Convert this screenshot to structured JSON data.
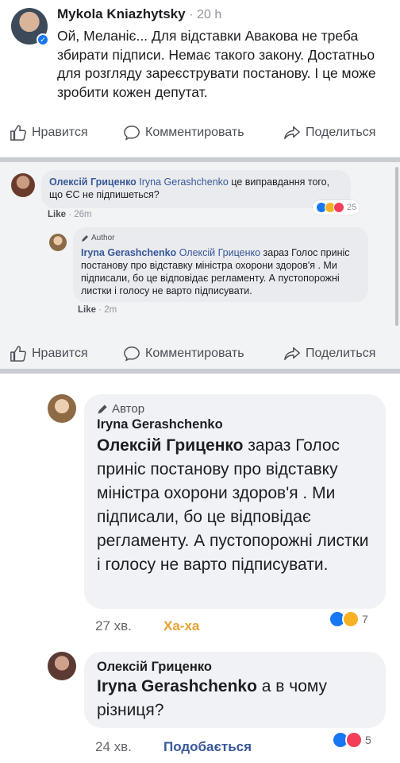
{
  "post": {
    "author": "Mykola Kniazhytsky",
    "time": "· 20 h",
    "text": "Ой, Меланіє... Для відставки Авакова не треба збирати підписи. Немає такого закону. Достатньо для розгляду зареєструвати постанову. І це може зробити кожен депутат."
  },
  "actions": {
    "like": "Нравится",
    "comment": "Комментировать",
    "share": "Поделиться"
  },
  "comment1": {
    "author": "Олексій Гриценко",
    "tag": "Iryna Gerashchenko",
    "text": " це виправдання того, що ЄС не підпишеться?",
    "like": "Like",
    "time": "· 26m",
    "reaction_count": "25"
  },
  "reply1": {
    "badge": "Author",
    "author": "Iryna Gerashchenko",
    "tag": "Олексій Гриценко",
    "text": " зараз Голос приніс постанову про відставку міністра охорони здоров'я . Ми підписали, бо це відповідає регламенту. А пустопорожні листки і голосу не варто підписувати.",
    "like": "Like",
    "time": "· 2m"
  },
  "reply2": {
    "badge": "Автор",
    "author": "Iryna Gerashchenko",
    "tag": "Олексій Гриценко",
    "text": " зараз Голос приніс постанову про відставку міністра охорони здоров'я . Ми підписали, бо це відповідає регламенту. А пустопорожні листки і голосу не варто підписувати.",
    "time": "27 хв.",
    "reaction_label": "Ха-ха",
    "reaction_count": "7"
  },
  "reply3": {
    "author": "Олексій Гриценко",
    "tag": "Iryna Gerashchenko",
    "text": " а в чому різниця?",
    "time": "24 хв.",
    "reaction_label": "Подобається",
    "reaction_count": "5"
  },
  "colors": {
    "link": "#385898",
    "like_blue": "#1877f2",
    "haha_yellow": "#f7b125",
    "love_red": "#f33e58",
    "haha_label": "#e8a12f"
  }
}
